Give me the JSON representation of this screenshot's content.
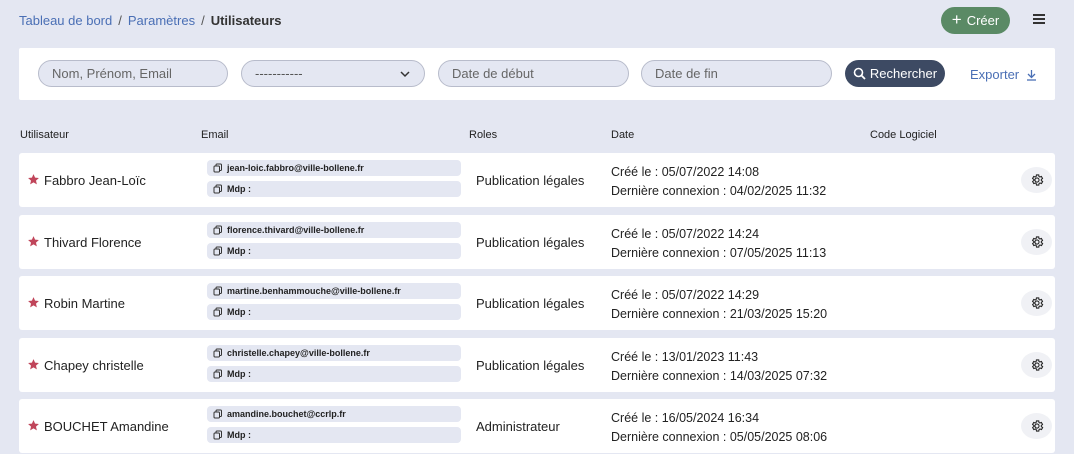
{
  "breadcrumb": {
    "item1": "Tableau de bord",
    "item2": "Paramètres",
    "current": "Utilisateurs",
    "separator": "/"
  },
  "header": {
    "create_label": "Créer",
    "create_icon": "plus-icon",
    "menu_icon": "hamburger-menu-icon"
  },
  "filters": {
    "name_placeholder": "Nom, Prénom, Email",
    "select_value": "-----------",
    "start_date_placeholder": "Date de début",
    "end_date_placeholder": "Date de fin",
    "search_label": "Rechercher",
    "export_label": "Exporter"
  },
  "table": {
    "columns": {
      "user": "Utilisateur",
      "email": "Email",
      "roles": "Roles",
      "date": "Date",
      "code": "Code Logiciel"
    },
    "rows": [
      {
        "name": "Fabbro Jean-Loïc",
        "email": "jean-loic.fabbro@ville-bollene.fr",
        "mdp": "Mdp :",
        "role": "Publication légales",
        "created": "Créé le : 05/07/2022 14:08",
        "last_login": "Dernière connexion : 04/02/2025 11:32"
      },
      {
        "name": "Thivard Florence",
        "email": "florence.thivard@ville-bollene.fr",
        "mdp": "Mdp :",
        "role": "Publication légales",
        "created": "Créé le : 05/07/2022 14:24",
        "last_login": "Dernière connexion : 07/05/2025 11:13"
      },
      {
        "name": "Robin Martine",
        "email": "martine.benhammouche@ville-bollene.fr",
        "mdp": "Mdp :",
        "role": "Publication légales",
        "created": "Créé le : 05/07/2022 14:29",
        "last_login": "Dernière connexion : 21/03/2025 15:20"
      },
      {
        "name": "Chapey christelle",
        "email": "christelle.chapey@ville-bollene.fr",
        "mdp": "Mdp :",
        "role": "Publication légales",
        "created": "Créé le : 13/01/2023 11:43",
        "last_login": "Dernière connexion : 14/03/2025 07:32"
      },
      {
        "name": "BOUCHET Amandine",
        "email": "amandine.bouchet@ccrlp.fr",
        "mdp": "Mdp :",
        "role": "Administrateur",
        "created": "Créé le : 16/05/2024 16:34",
        "last_login": "Dernière connexion : 05/05/2025 08:06"
      }
    ]
  },
  "colors": {
    "background": "#e4e7f2",
    "create_button": "#5a8a65",
    "search_button": "#3d4a63",
    "link": "#4a6fb5",
    "star": "#c0455a"
  }
}
